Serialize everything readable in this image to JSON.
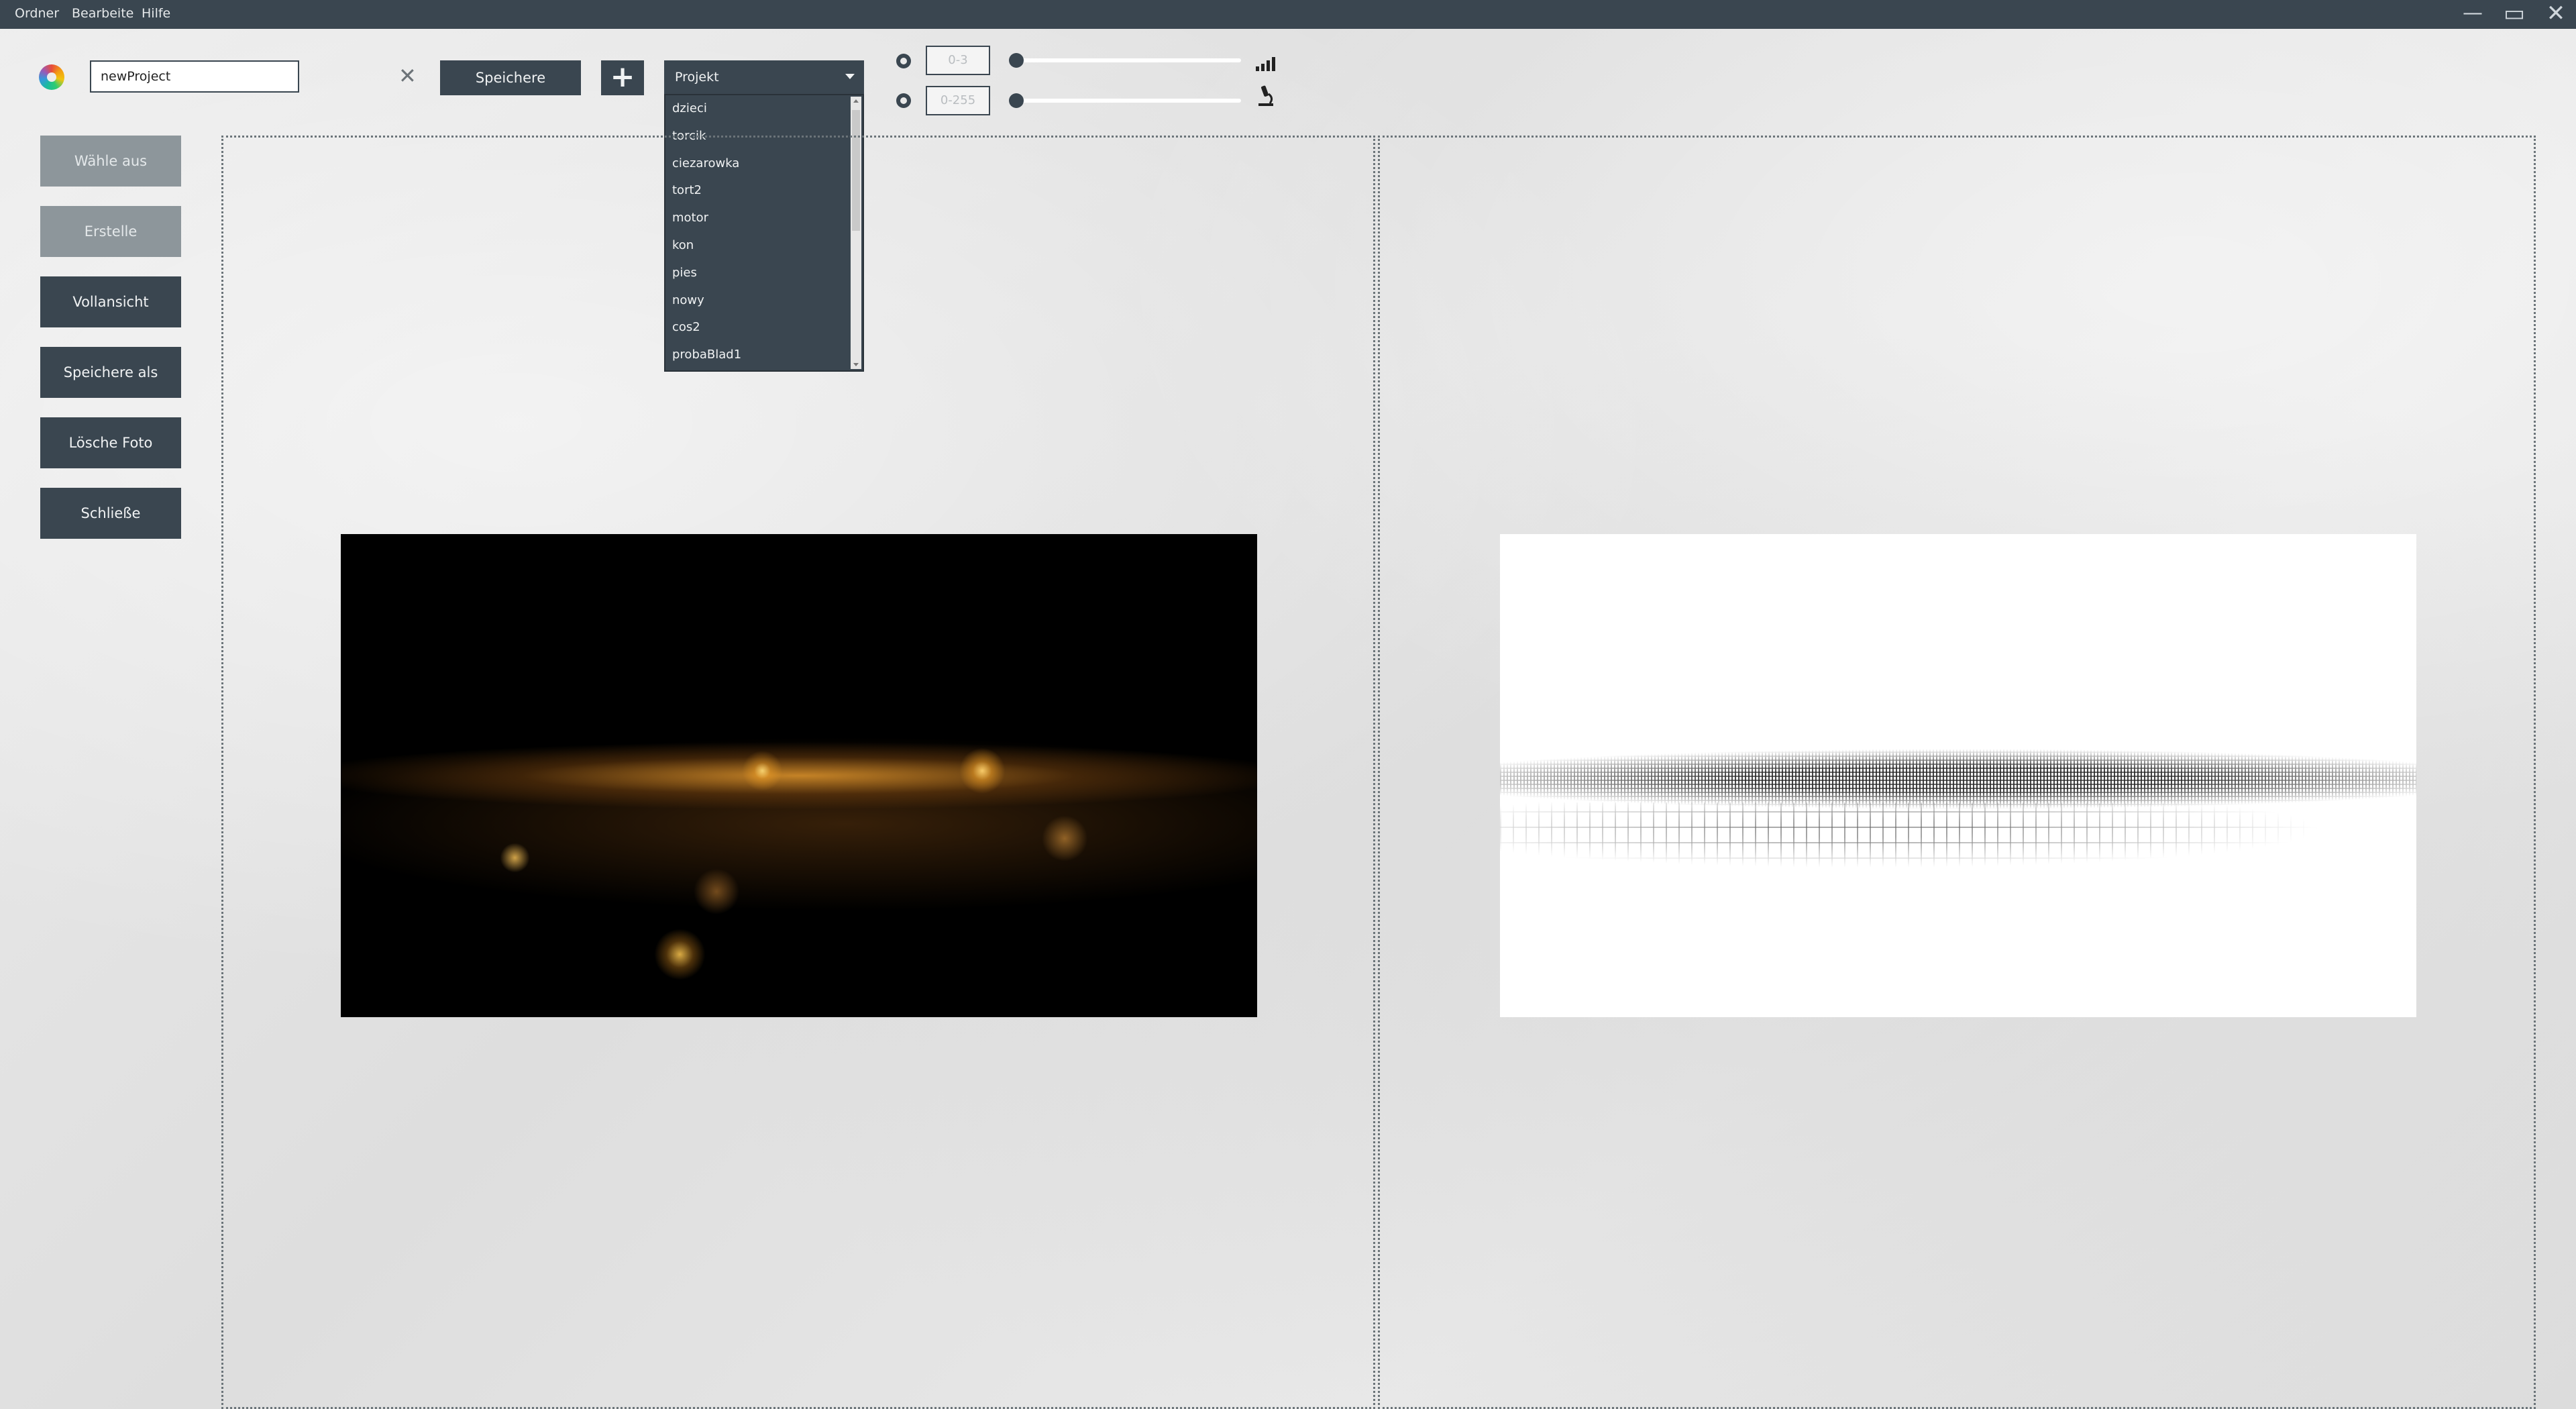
{
  "menubar": {
    "items": [
      "Ordner",
      "Bearbeite",
      "Hilfe"
    ]
  },
  "window_controls": {
    "minimize": "—",
    "maximize": "▭",
    "close": "✕"
  },
  "toolbar": {
    "project_name_value": "newProject",
    "clear_glyph": "✕",
    "save_label": "Speichere",
    "add_glyph": "+",
    "project_dropdown": {
      "selected": "Projekt",
      "options": [
        "dzieci",
        "torcik",
        "ciezarowka",
        "tort2",
        "motor",
        "kon",
        "pies",
        "nowy",
        "cos2",
        "probaBlad1"
      ]
    },
    "range_fields": [
      {
        "placeholder": "0-3",
        "level": 0
      },
      {
        "placeholder": "0-255",
        "level": 0
      }
    ],
    "icons": [
      "signal-icon",
      "microscope-icon"
    ]
  },
  "sidebar": {
    "buttons": [
      {
        "label": "Wähle aus",
        "state": "disabled"
      },
      {
        "label": "Erstelle",
        "state": "disabled"
      },
      {
        "label": "Vollansicht",
        "state": "active"
      },
      {
        "label": "Speichere als",
        "state": "active"
      },
      {
        "label": "Lösche Foto",
        "state": "active"
      },
      {
        "label": "Schließe",
        "state": "active"
      }
    ]
  },
  "colors": {
    "accent": "#3a4650",
    "disabled": "#8d969b",
    "background": "#e4e4e4"
  }
}
